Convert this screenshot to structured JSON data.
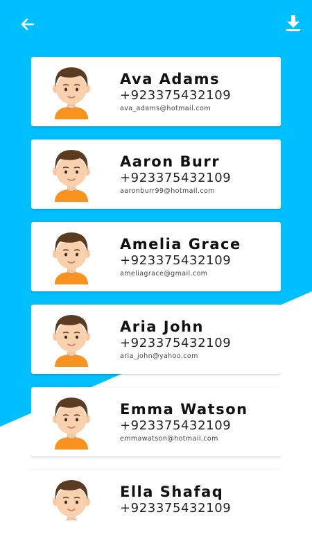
{
  "colors": {
    "background": "#00BFFF",
    "card": "#FFFFFF",
    "icon": "#FFFFFF"
  },
  "header": {
    "back_icon": "arrow-left-icon",
    "download_icon": "download-icon"
  },
  "contacts": [
    {
      "name": "Ava Adams",
      "phone": "+923375432109",
      "email": "ava_adams@hotmail.com"
    },
    {
      "name": "Aaron Burr",
      "phone": "+923375432109",
      "email": "aaronburr99@hotmail.com"
    },
    {
      "name": "Amelia Grace",
      "phone": "+923375432109",
      "email": "ameliagrace@gmail.com"
    },
    {
      "name": "Aria John",
      "phone": "+923375432109",
      "email": "aria_john@yahoo.com"
    },
    {
      "name": "Emma Watson",
      "phone": "+923375432109",
      "email": "emmawatson@hotmail.com"
    },
    {
      "name": "Ella Shafaq",
      "phone": "+923375432109",
      "email": ""
    }
  ]
}
